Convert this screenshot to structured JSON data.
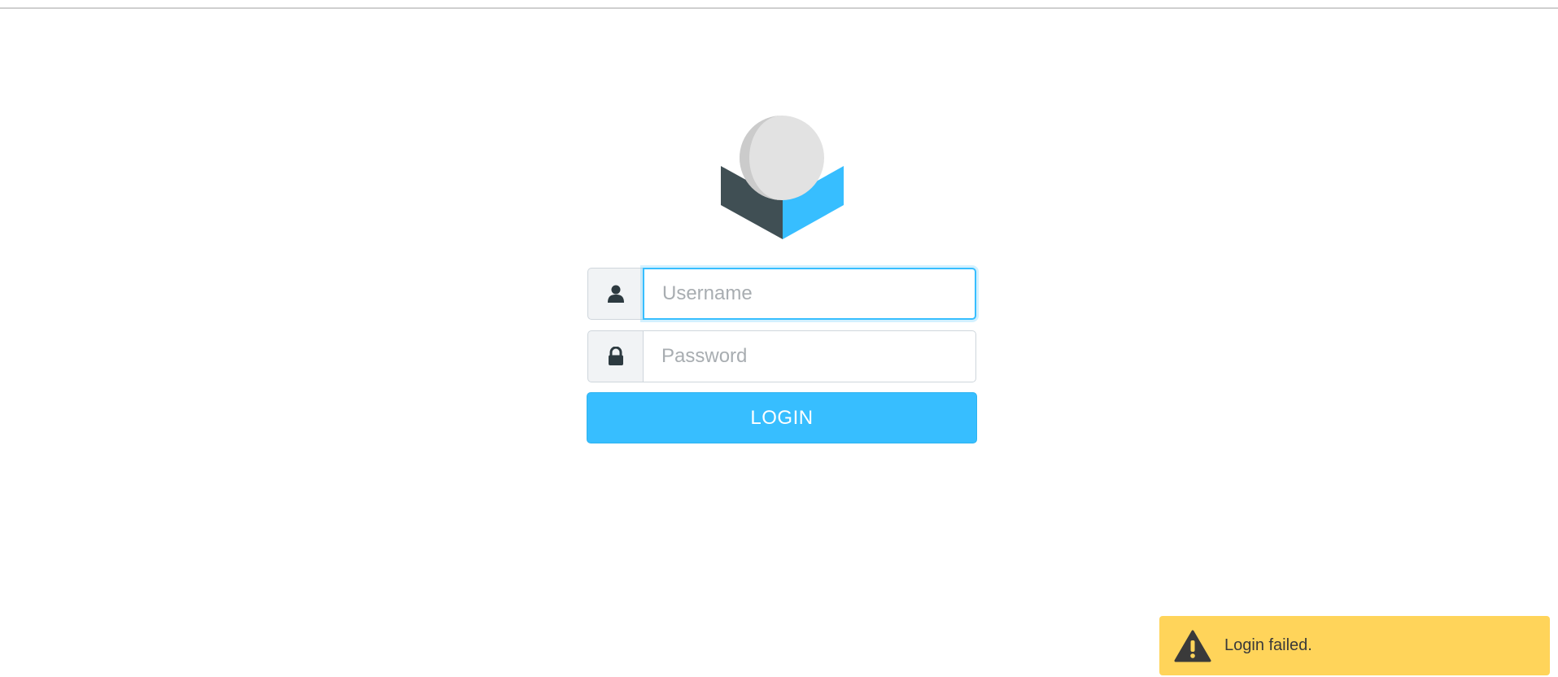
{
  "login_form": {
    "username": {
      "placeholder": "Username",
      "value": "",
      "icon": "user-icon"
    },
    "password": {
      "placeholder": "Password",
      "value": "",
      "icon": "lock-icon"
    },
    "submit_label": "LOGIN"
  },
  "notification": {
    "type": "warning",
    "icon": "warning-icon",
    "message": "Login failed."
  },
  "colors": {
    "accent": "#37beff",
    "warning_bg": "#ffd45a",
    "logo_dark": "#404f54",
    "logo_light": "#e2e2e2"
  }
}
